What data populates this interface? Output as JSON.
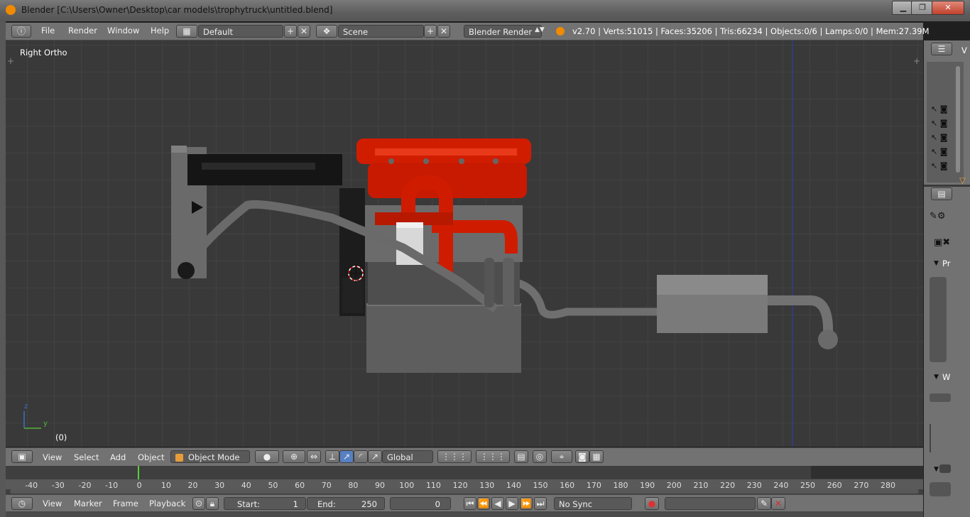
{
  "window": {
    "title": "Blender [C:\\Users\\Owner\\Desktop\\car models\\trophytruck\\untitled.blend]",
    "controls": [
      "▁",
      "❐",
      "✕"
    ]
  },
  "info_header": {
    "menus": [
      "File",
      "Render",
      "Window",
      "Help"
    ],
    "layout": "Default",
    "scene": "Scene",
    "engine": "Blender Render",
    "stats": "v2.70 | Verts:51015 | Faces:35206 | Tris:66234 | Objects:0/6 | Lamps:0/0 | Mem:27.39M"
  },
  "viewport": {
    "view_label": "Right Ortho",
    "frame_label": "(0)",
    "axes": {
      "z": "z",
      "y": "y"
    }
  },
  "view3d_header": {
    "menus": [
      "View",
      "Select",
      "Add",
      "Object"
    ],
    "mode": "Object Mode",
    "orientation": "Global"
  },
  "timeline": {
    "ticks": [
      "-40",
      "-30",
      "-20",
      "-10",
      "0",
      "10",
      "20",
      "30",
      "40",
      "50",
      "60",
      "70",
      "80",
      "90",
      "100",
      "110",
      "120",
      "130",
      "140",
      "150",
      "160",
      "170",
      "180",
      "190",
      "200",
      "210",
      "220",
      "230",
      "240",
      "250",
      "260",
      "270",
      "280"
    ],
    "current_frame_marker": 0
  },
  "timeline_header": {
    "menus": [
      "View",
      "Marker",
      "Frame",
      "Playback"
    ],
    "start_label": "Start:",
    "start_value": "1",
    "end_label": "End:",
    "end_value": "250",
    "current_frame": "0",
    "sync": "No Sync"
  },
  "right_panel": {
    "section_pr": "Pr",
    "section_w": "W",
    "top_letter": "V"
  },
  "colors": {
    "engine_red": "#d01d00",
    "viewport_bg": "#393939",
    "header_bg": "#727272",
    "frame_marker": "#56d13a"
  }
}
